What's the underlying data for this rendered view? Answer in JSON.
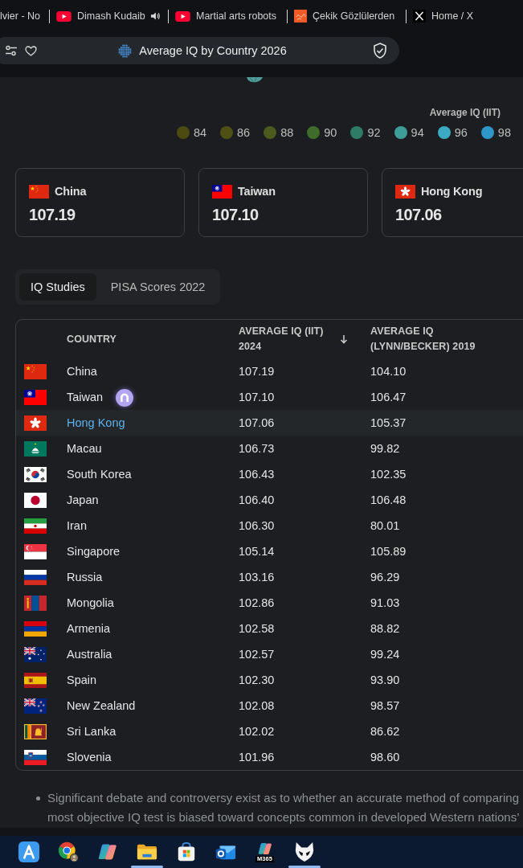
{
  "browser_tabs": [
    {
      "kind": "plain",
      "title": "lvier - No",
      "audio": false
    },
    {
      "kind": "video",
      "title": "Dimash Kudaib",
      "audio": true
    },
    {
      "kind": "video",
      "title": "Martial arts robots",
      "audio": false
    },
    {
      "kind": "tile",
      "title": "Çekik Gözlülerden",
      "audio": false
    },
    {
      "kind": "x",
      "title": "Home / X",
      "audio": false
    }
  ],
  "address_bar": {
    "title": "Average IQ by Country 2026"
  },
  "legend": {
    "title": "Average IQ (IIT)",
    "items": [
      {
        "label": "84",
        "color": "#4b4b12"
      },
      {
        "label": "86",
        "color": "#4f5014"
      },
      {
        "label": "88",
        "color": "#4b5b1d"
      },
      {
        "label": "90",
        "color": "#3f6c2b"
      },
      {
        "label": "92",
        "color": "#2e7b66"
      },
      {
        "label": "94",
        "color": "#3f9d98"
      },
      {
        "label": "96",
        "color": "#3caac3"
      },
      {
        "label": "98",
        "color": "#2f97c7"
      }
    ]
  },
  "top_cards": [
    {
      "kind": "cn",
      "name": "China",
      "value": "107.19"
    },
    {
      "kind": "tw",
      "name": "Taiwan",
      "value": "107.10"
    },
    {
      "kind": "hk",
      "name": "Hong Kong",
      "value": "107.06"
    }
  ],
  "view_tabs": [
    {
      "label": "IQ Studies",
      "selected": true
    },
    {
      "label": "PISA Scores 2022",
      "selected": false
    }
  ],
  "table": {
    "columns": [
      {
        "label": "COUNTRY",
        "sorted": false
      },
      {
        "label": "AVERAGE IQ (IIT) 2024",
        "sorted": true
      },
      {
        "label": "AVERAGE IQ (LYNN/BECKER) 2019",
        "sorted": false
      }
    ],
    "rows": [
      {
        "kind": "cn",
        "country": "China",
        "iit_2024": "107.19",
        "lynn_becker_2019": "104.10",
        "highlighted": false
      },
      {
        "kind": "tw",
        "country": "Taiwan",
        "iit_2024": "107.10",
        "lynn_becker_2019": "106.47",
        "highlighted": false
      },
      {
        "kind": "hk",
        "country": "Hong Kong",
        "iit_2024": "107.06",
        "lynn_becker_2019": "105.37",
        "highlighted": true
      },
      {
        "kind": "mo",
        "country": "Macau",
        "iit_2024": "106.73",
        "lynn_becker_2019": "99.82",
        "highlighted": false
      },
      {
        "kind": "kr",
        "country": "South Korea",
        "iit_2024": "106.43",
        "lynn_becker_2019": "102.35",
        "highlighted": false
      },
      {
        "kind": "jp",
        "country": "Japan",
        "iit_2024": "106.40",
        "lynn_becker_2019": "106.48",
        "highlighted": false
      },
      {
        "kind": "ir",
        "country": "Iran",
        "iit_2024": "106.30",
        "lynn_becker_2019": "80.01",
        "highlighted": false
      },
      {
        "kind": "sg",
        "country": "Singapore",
        "iit_2024": "105.14",
        "lynn_becker_2019": "105.89",
        "highlighted": false
      },
      {
        "kind": "ru",
        "country": "Russia",
        "iit_2024": "103.16",
        "lynn_becker_2019": "96.29",
        "highlighted": false
      },
      {
        "kind": "mn",
        "country": "Mongolia",
        "iit_2024": "102.86",
        "lynn_becker_2019": "91.03",
        "highlighted": false
      },
      {
        "kind": "am",
        "country": "Armenia",
        "iit_2024": "102.58",
        "lynn_becker_2019": "88.82",
        "highlighted": false
      },
      {
        "kind": "au",
        "country": "Australia",
        "iit_2024": "102.57",
        "lynn_becker_2019": "99.24",
        "highlighted": false
      },
      {
        "kind": "es",
        "country": "Spain",
        "iit_2024": "102.30",
        "lynn_becker_2019": "93.90",
        "highlighted": false
      },
      {
        "kind": "nz",
        "country": "New Zealand",
        "iit_2024": "102.08",
        "lynn_becker_2019": "98.57",
        "highlighted": false
      },
      {
        "kind": "lk",
        "country": "Sri Lanka",
        "iit_2024": "102.02",
        "lynn_becker_2019": "86.62",
        "highlighted": false
      },
      {
        "kind": "si",
        "country": "Slovenia",
        "iit_2024": "101.96",
        "lynn_becker_2019": "98.60",
        "highlighted": false
      }
    ]
  },
  "notes": [
    {
      "lines": [
        "Significant debate and controversy exist as to whether an accurate method of comparing",
        "most objective IQ test is biased toward concepts common in developed Western nations’"
      ]
    }
  ],
  "taskbar": {
    "items": [
      {
        "kind": "tile",
        "running": false
      },
      {
        "kind": "ring",
        "running": false
      },
      {
        "kind": "swirl",
        "running": false
      },
      {
        "kind": "folder",
        "running": true
      },
      {
        "kind": "bag",
        "running": false
      },
      {
        "kind": "mail",
        "running": false
      },
      {
        "kind": "swirl",
        "badge": "M365",
        "running": false
      },
      {
        "kind": "head",
        "running": true
      }
    ]
  }
}
